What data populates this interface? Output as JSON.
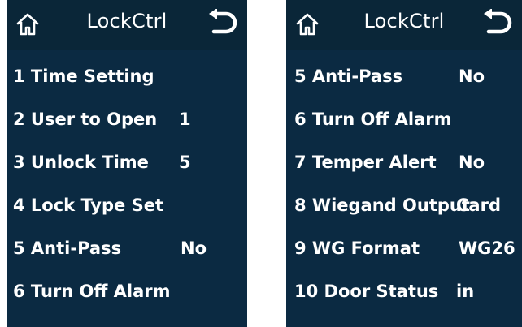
{
  "left_screen": {
    "title": "LockCtrl",
    "items": [
      {
        "label": "1  Time Setting",
        "value": ""
      },
      {
        "label": "2  User to Open",
        "value": "1"
      },
      {
        "label": "3  Unlock Time",
        "value": "5"
      },
      {
        "label": "4  Lock Type Set",
        "value": ""
      },
      {
        "label": "5  Anti-Pass",
        "value": "No"
      },
      {
        "label": "6  Turn Off Alarm",
        "value": ""
      }
    ]
  },
  "right_screen": {
    "title": "LockCtrl",
    "items": [
      {
        "label": "5  Anti-Pass",
        "value": "No"
      },
      {
        "label": "6  Turn Off Alarm",
        "value": ""
      },
      {
        "label": "7  Temper Alert",
        "value": "No"
      },
      {
        "label": "8  Wiegand Output",
        "value": "Card"
      },
      {
        "label": "9  WG Format",
        "value": "WG26"
      },
      {
        "label": "10  Door Status",
        "value": "in"
      }
    ]
  },
  "colors": {
    "screen_background": "#0b2a42",
    "text": "#ffffff"
  },
  "icons": {
    "home": "home-icon",
    "back": "back-arrow-icon"
  }
}
